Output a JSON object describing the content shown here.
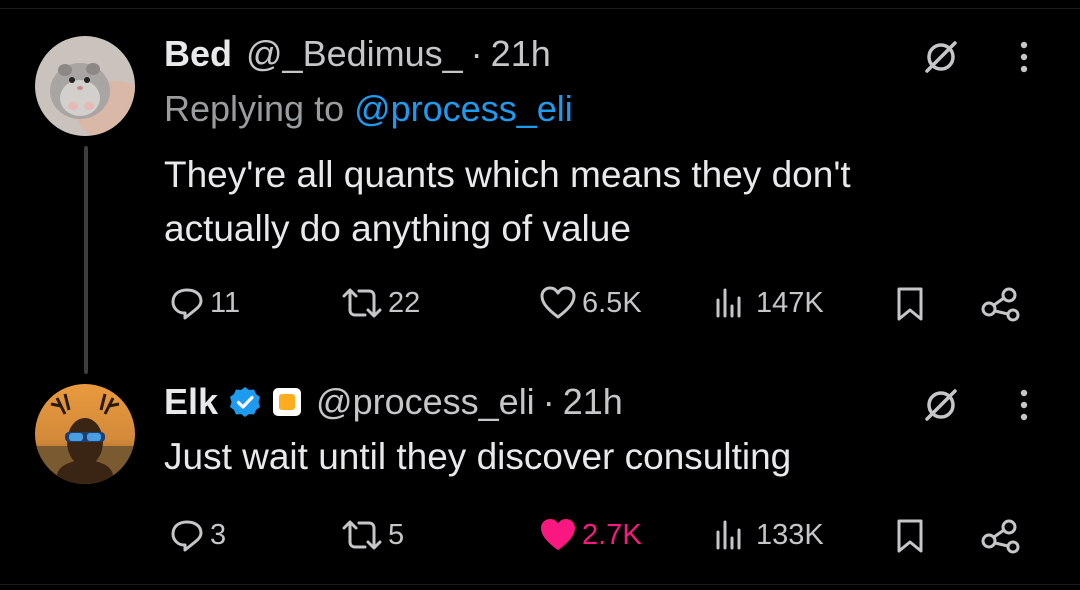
{
  "tweets": [
    {
      "name": "Bed",
      "handle": "@_Bedimus_",
      "separator": "·",
      "time": "21h",
      "replying_prefix": "Replying to ",
      "replying_to": "@process_eli",
      "text_lines": [
        "They're all quants which means they don't",
        "actually do anything of value"
      ],
      "replies": "11",
      "retweets": "22",
      "likes": "6.5K",
      "views": "147K",
      "liked": false
    },
    {
      "name": "Elk",
      "handle": "@process_eli",
      "separator": "·",
      "time": "21h",
      "text_lines": [
        "Just wait until they discover consulting"
      ],
      "replies": "3",
      "retweets": "5",
      "likes": "2.7K",
      "views": "133K",
      "liked": true
    }
  ],
  "colors": {
    "background": "#000000",
    "text": "#e7e9ea",
    "muted": "#c4c6c8",
    "link": "#1d9bf0",
    "like_active": "#f91880",
    "verified": "#1d9bf0",
    "affiliate_badge": "#ffad1f"
  },
  "icons": [
    "grok-icon",
    "more-icon",
    "reply-icon",
    "retweet-icon",
    "like-icon",
    "views-icon",
    "bookmark-icon",
    "share-icon",
    "verified-icon",
    "affiliate-badge-icon"
  ]
}
